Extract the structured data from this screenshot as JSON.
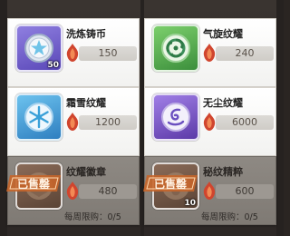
{
  "shop": {
    "items": [
      {
        "name": "洗炼铸币",
        "price": "150",
        "qty": "50",
        "icon": "star-coin-icon",
        "frame_color": "#6a5cc9"
      },
      {
        "name": "气旋纹耀",
        "price": "240",
        "qty": "",
        "icon": "triskelion-emblem-icon",
        "frame_color": "#3f9a3f"
      },
      {
        "name": "霜雪纹耀",
        "price": "1200",
        "qty": "",
        "icon": "snowflake-emblem-icon",
        "frame_color": "#2f8fc9"
      },
      {
        "name": "无尘纹耀",
        "price": "6000",
        "qty": "",
        "icon": "swan-emblem-icon",
        "frame_color": "#7a4fc2"
      },
      {
        "name": "纹耀徽章",
        "price": "480",
        "qty": "",
        "icon": "badge-icon",
        "limit": "每周限购：0/5",
        "sold_out_label": "已售罄"
      },
      {
        "name": "秘纹精粹",
        "price": "600",
        "qty": "10",
        "icon": "essence-icon",
        "limit": "每周限购：0/5",
        "sold_out_label": "已售罄"
      }
    ]
  },
  "colors": {
    "currency_gem": "#d0452e",
    "sold_out_stamp": "#c7652a"
  }
}
